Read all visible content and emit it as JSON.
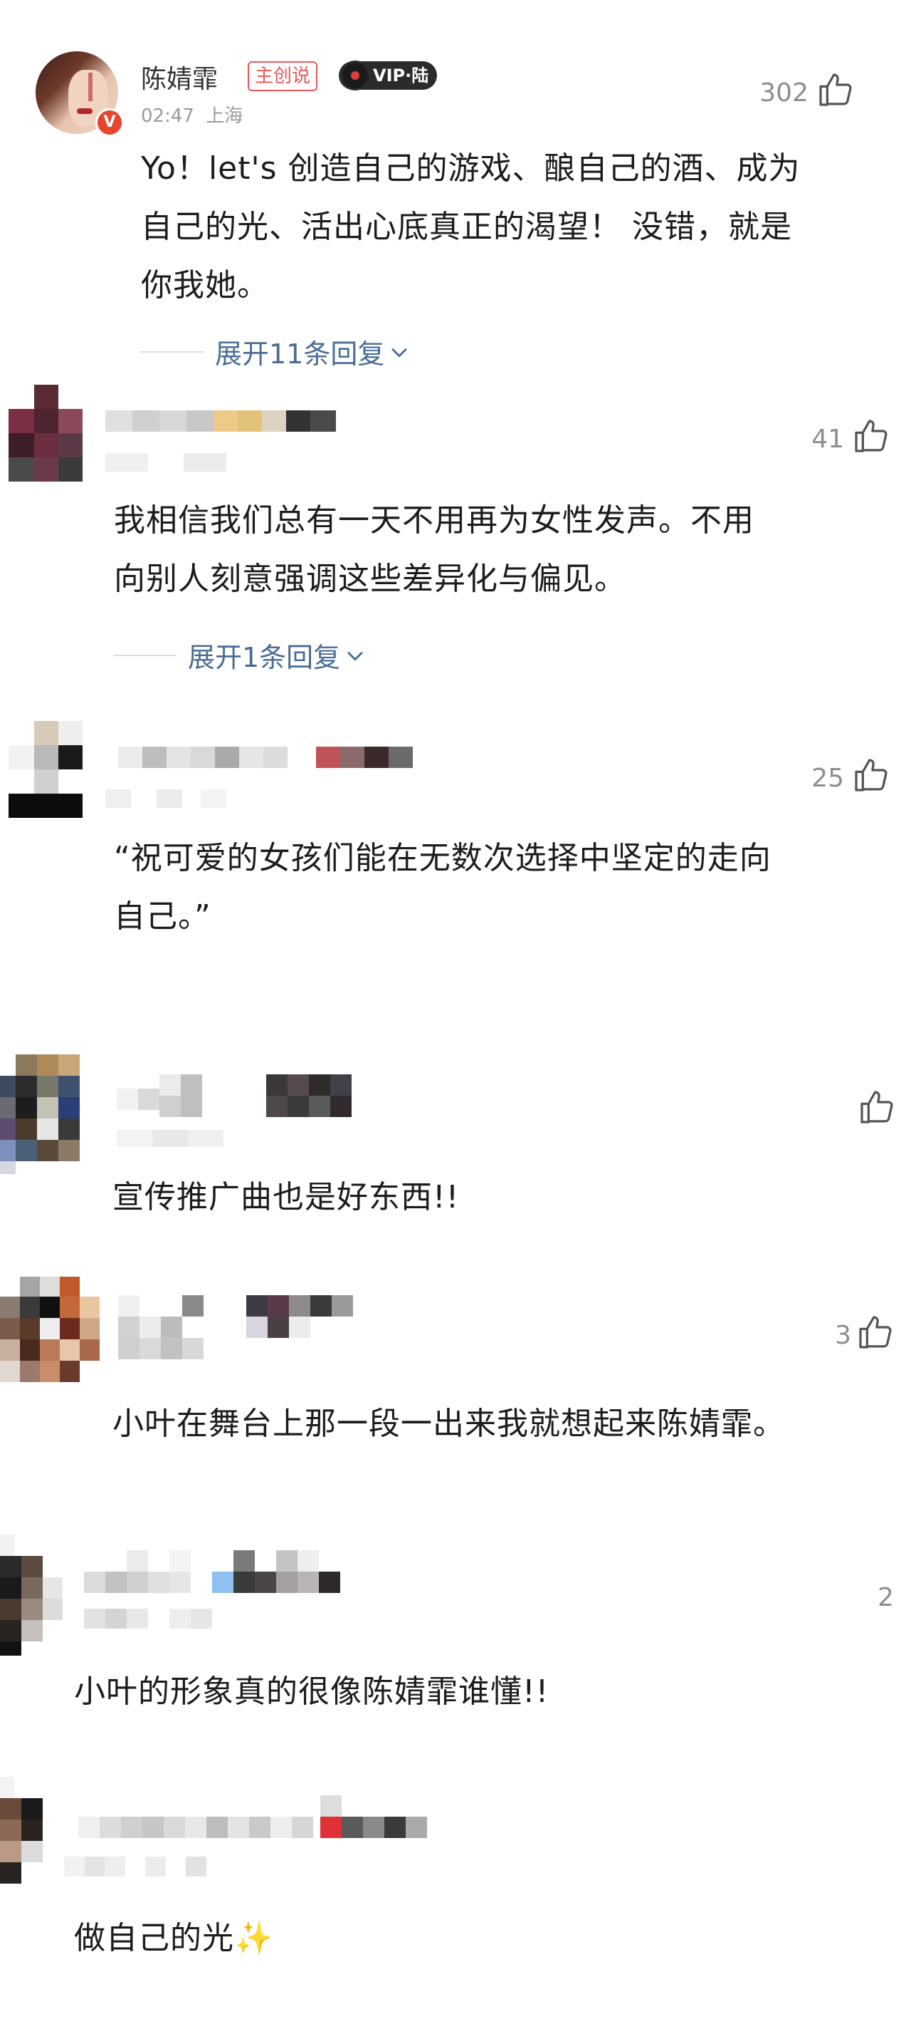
{
  "comments": [
    {
      "author": "陈婧霏",
      "badge": "主创说",
      "vip": "VIP·陆",
      "time": "02:47",
      "location": "上海",
      "likes": "302",
      "text_lines": [
        "Yo！let's 创造自己的游戏、酿自己的酒、成为",
        "自己的光、活出心底真正的渴望！ 没错，就是",
        "你我她。"
      ],
      "replies": "展开11条回复"
    },
    {
      "likes": "41",
      "text_lines": [
        "我相信我们总有一天不用再为女性发声。不用",
        "向别人刻意强调这些差异化与偏见。"
      ],
      "replies": "展开1条回复"
    },
    {
      "likes": "25",
      "text_lines": [
        "“祝可爱的女孩们能在无数次选择中坚定的走向",
        "自己。”"
      ]
    },
    {
      "likes": "",
      "text_lines": [
        "宣传推广曲也是好东西!!"
      ]
    },
    {
      "likes": "3",
      "text_lines": [
        "小叶在舞台上那一段一出来我就想起来陈婧霏。"
      ]
    },
    {
      "likes": "2",
      "text_lines": [
        "小叶的形象真的很像陈婧霏谁懂!!"
      ]
    },
    {
      "likes": "",
      "text_lines": [
        "做自己的光✨"
      ]
    }
  ],
  "colors": {
    "link": "#4a6d95",
    "badge": "#e8585a",
    "muted": "#9a9a9a"
  },
  "icons": [
    "thumbs-up-icon",
    "chevron-down-icon",
    "verified-v-icon",
    "vinyl-disc-icon"
  ]
}
